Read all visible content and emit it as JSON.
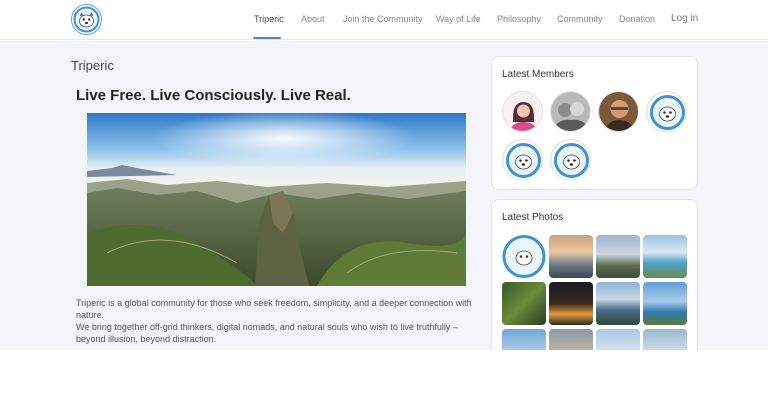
{
  "nav": {
    "items": [
      {
        "label": "Triperic",
        "active": true
      },
      {
        "label": "About"
      },
      {
        "label": "Join the Community"
      },
      {
        "label": "Way of Life"
      },
      {
        "label": "Philosophy"
      },
      {
        "label": "Community"
      },
      {
        "label": "Donation"
      }
    ],
    "login_label": "Log in",
    "accent_color": "#5b7fd8"
  },
  "page": {
    "title": "Triperic",
    "headline": "Live Free. Live Consciously. Live Real.",
    "paragraphs": [
      "Triperic is a global community for those who seek freedom, simplicity, and a deeper connection with nature.",
      "We bring together off-grid thinkers, digital nomads, and natural souls who wish to live truthfully – beyond illusion, beyond distraction."
    ]
  },
  "sidebar": {
    "members_title": "Latest Members",
    "photos_title": "Latest Photos"
  }
}
